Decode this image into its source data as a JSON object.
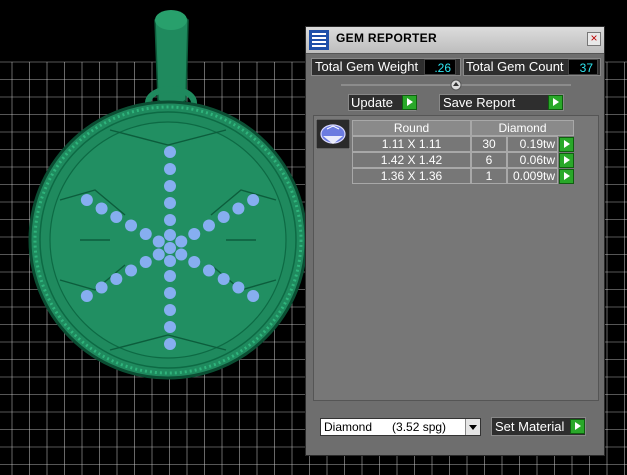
{
  "viewport": {
    "background": "#000000",
    "grid_color": "#d8d8d8",
    "model_color": "#1f8a5e",
    "gem_color": "#86aef0"
  },
  "panel": {
    "title": "GEM REPORTER",
    "close_label": "×",
    "total_weight_label": "Total Gem Weight",
    "total_weight_value": ".26",
    "total_count_label": "Total Gem Count",
    "total_count_value": "37",
    "update_label": "Update",
    "save_report_label": "Save Report"
  },
  "table": {
    "shape_header": "Round",
    "material_header": "Diamond",
    "rows": [
      {
        "size": "1.11 X 1.11",
        "count": "30",
        "weight": "0.19tw"
      },
      {
        "size": "1.42 X 1.42",
        "count": "6",
        "weight": "0.06tw"
      },
      {
        "size": "1.36 X 1.36",
        "count": "1",
        "weight": "0.009tw"
      }
    ]
  },
  "material": {
    "selected": "Diamond      (3.52 spg)",
    "set_label": "Set Material"
  }
}
